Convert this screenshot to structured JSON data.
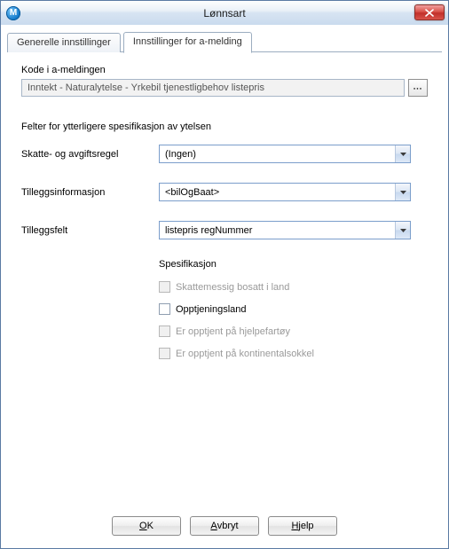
{
  "window": {
    "title": "Lønnsart",
    "app_icon_letter": "M"
  },
  "tabs": {
    "general": "Generelle innstillinger",
    "amelding": "Innstillinger for a-melding"
  },
  "kode": {
    "label": "Kode i a-meldingen",
    "value": "Inntekt - Naturalytelse - Yrkebil tjenestligbehov listepris"
  },
  "fields_heading": "Felter for ytterligere spesifikasjon av ytelsen",
  "rows": {
    "skatte": {
      "label": "Skatte- og avgiftsregel",
      "value": "(Ingen)"
    },
    "tillegg_info": {
      "label": "Tilleggsinformasjon",
      "value": "<bilOgBaat>"
    },
    "tillegg_felt": {
      "label": "Tilleggsfelt",
      "value": "listepris regNummer"
    }
  },
  "spec": {
    "heading": "Spesifikasjon",
    "skattemessig": "Skattemessig bosatt i land",
    "opptjeningsland": "Opptjeningsland",
    "hjelpefartoy": "Er opptjent på hjelpefartøy",
    "kontinentalsokkel": "Er opptjent på kontinentalsokkel"
  },
  "buttons": {
    "ok_pre": "",
    "ok_u": "O",
    "ok_post": "K",
    "avbryt_pre": "",
    "avbryt_u": "A",
    "avbryt_post": "vbryt",
    "hjelp_pre": "",
    "hjelp_u": "H",
    "hjelp_post": "jelp"
  }
}
